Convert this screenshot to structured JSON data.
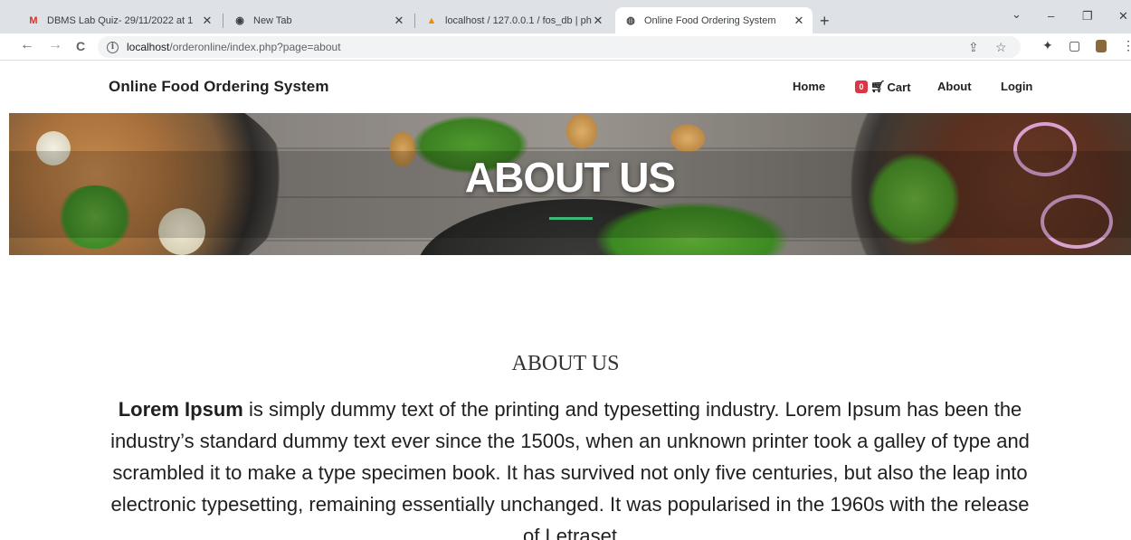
{
  "browser": {
    "tabs": [
      {
        "favicon": "gmail-icon",
        "title": "DBMS Lab Quiz- 29/11/2022 at 1",
        "active": false
      },
      {
        "favicon": "chrome-icon",
        "title": "New Tab",
        "active": false
      },
      {
        "favicon": "phpmyadmin-icon",
        "title": "localhost / 127.0.0.1 / fos_db | ph",
        "active": false
      },
      {
        "favicon": "globe-icon",
        "title": "Online Food Ordering System",
        "active": true
      }
    ],
    "url_host": "localhost",
    "url_path": "/orderonline/index.php?page=about",
    "icons": {
      "back": "←",
      "forward": "→",
      "reload": "C",
      "share": "⇪",
      "bookmark": "☆",
      "extensions": "✦",
      "sidepanel": "▢",
      "newtab": "+",
      "dropdown": "⌄",
      "minimize": "–",
      "restore": "❐",
      "close": "✕",
      "menu": "⋮"
    }
  },
  "site": {
    "brand": "Online Food Ordering System",
    "nav": {
      "home": "Home",
      "cart_count": "0",
      "cart": "Cart",
      "about": "About",
      "login": "Login"
    },
    "hero_title": "ABOUT US"
  },
  "content": {
    "heading": "ABOUT US",
    "lead_bold": "Lorem Ipsum",
    "paragraph": " is simply dummy text of the printing and typesetting industry. Lorem Ipsum has been the industry’s standard dummy text ever since the 1500s, when an unknown printer took a galley of type and scrambled it to make a type specimen book. It has survived not only five centuries, but also the leap into electronic typesetting, remaining essentially unchanged. It was popularised in the 1960s with the release of Letraset"
  },
  "colors": {
    "accent_green": "#3cb878",
    "badge_red": "#dc3545",
    "chrome_bg": "#dee1e6"
  }
}
